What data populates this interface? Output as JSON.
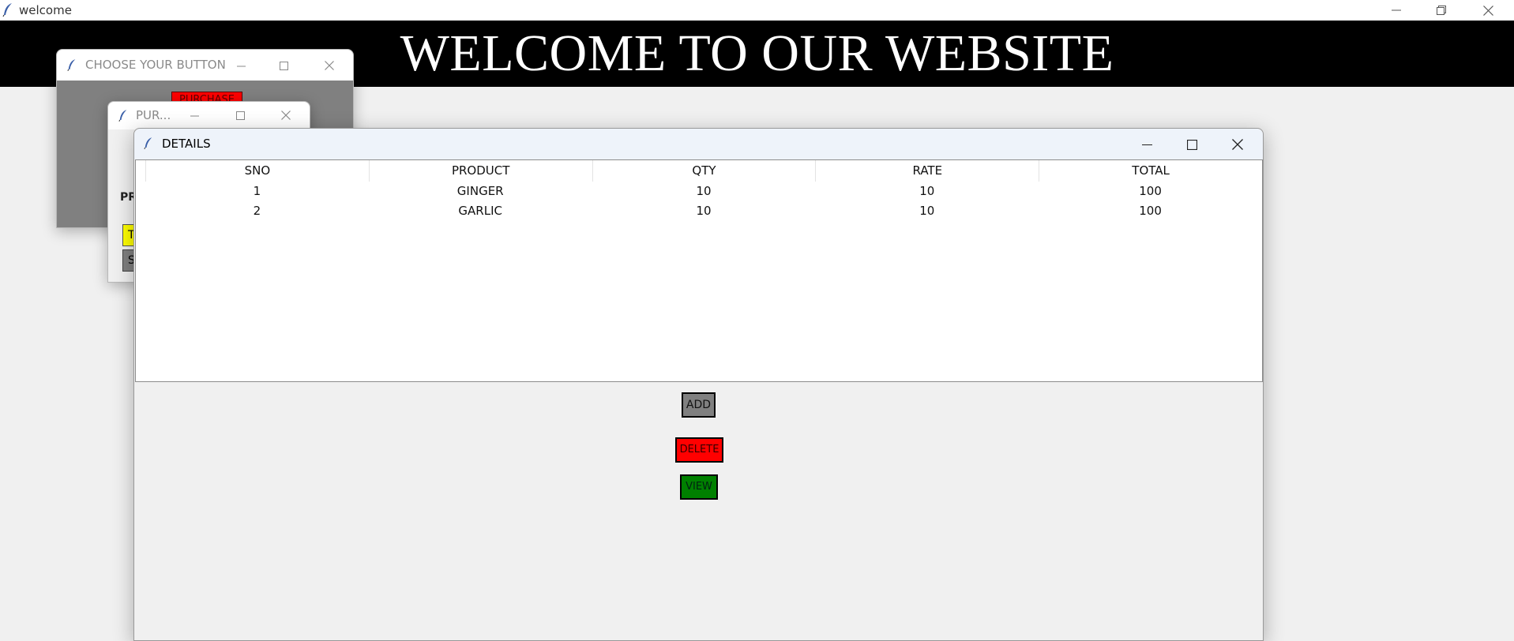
{
  "main_window": {
    "title": "welcome",
    "banner": "WELCOME TO OUR WEBSITE"
  },
  "choose_window": {
    "title": "CHOOSE YOUR BUTTON",
    "purchase_button": "PURCHASE"
  },
  "purchase_window": {
    "title": "PUR...",
    "label_partial": "PR",
    "yellow_button_partial": "T",
    "gray_button_partial": "S"
  },
  "details_window": {
    "title": "DETAILS",
    "columns": [
      "SNO",
      "PRODUCT",
      "QTY",
      "RATE",
      "TOTAL"
    ],
    "rows": [
      [
        "1",
        "GINGER",
        "10",
        "10",
        "100"
      ],
      [
        "2",
        "GARLIC",
        "10",
        "10",
        "100"
      ]
    ],
    "buttons": {
      "add": "ADD",
      "delete": "DELETE",
      "view": "VIEW"
    }
  },
  "colors": {
    "banner_bg": "#000000",
    "add_bg": "#808080",
    "delete_bg": "#ff0000",
    "view_bg": "#008000",
    "yellow": "#ffff00"
  }
}
